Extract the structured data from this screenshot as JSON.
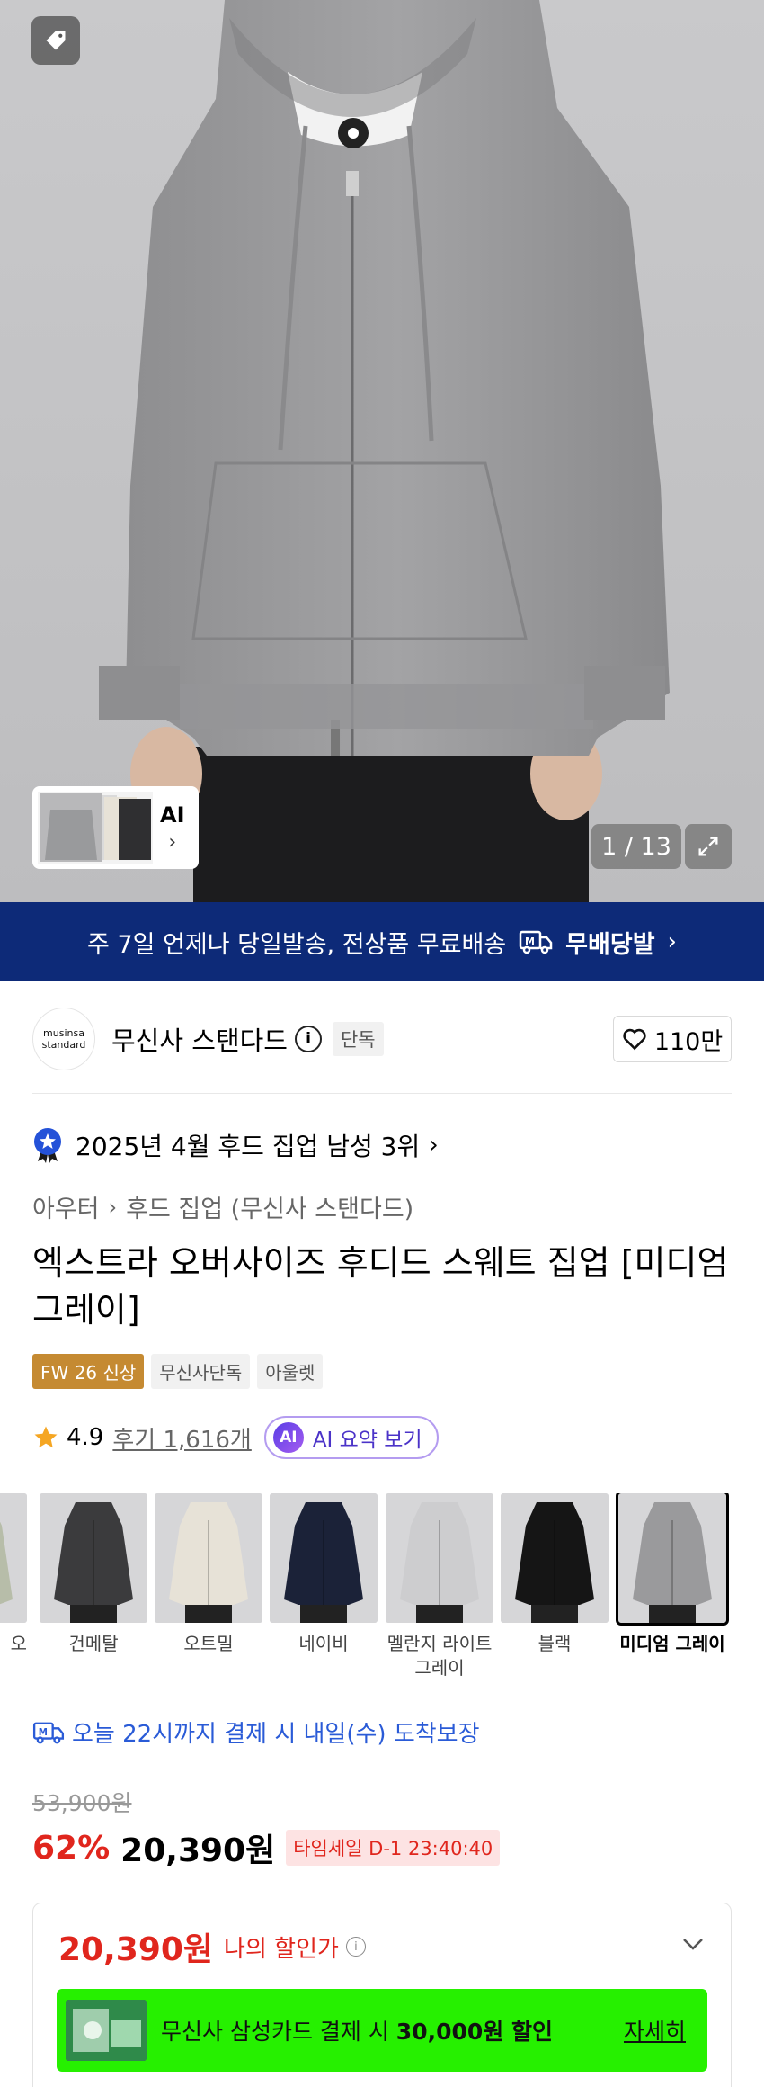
{
  "gallery": {
    "counter": "1 / 13",
    "ai_label": "AI",
    "ai_chevron": "›"
  },
  "banner": {
    "text": "주 7일 언제나 당일발송, 전상품 무료배송",
    "free_label": "무배당발",
    "chevron": "›",
    "background": "#0d2a78"
  },
  "brand": {
    "logo_line1": "musinsa",
    "logo_line2": "standard",
    "name": "무신사 스탠다드",
    "info": "i",
    "exclusive_badge": "단독",
    "likes": "110만"
  },
  "rank": {
    "text": "2025년 4월 후드 집업 남성 3위",
    "chevron": "›"
  },
  "breadcrumb": {
    "level1": "아우터",
    "sep": "›",
    "level2": "후드 집업 (무신사 스탠다드)"
  },
  "product": {
    "title": "엑스트라 오버사이즈 후디드 스웨트 집업 [미디엄 그레이]",
    "tags": [
      "FW 26 신상",
      "무신사단독",
      "아울렛"
    ]
  },
  "rating": {
    "score": "4.9",
    "reviews": "후기 1,616개",
    "ai_icon": "AI",
    "ai_summary": "AI 요약 보기"
  },
  "colors": [
    {
      "label": "오",
      "color": "#b7bda9"
    },
    {
      "label": "건메탈",
      "color": "#3b3b3d"
    },
    {
      "label": "오트밀",
      "color": "#e7e2d7"
    },
    {
      "label": "네이비",
      "color": "#1b2238"
    },
    {
      "label": "멜란지 라이트 그레이",
      "color": "#cdcdcf"
    },
    {
      "label": "블랙",
      "color": "#151515"
    },
    {
      "label": "미디엄 그레이",
      "color": "#9a9a9c"
    }
  ],
  "delivery": {
    "text": "오늘 22시까지 결제 시 내일(수) 도착보장",
    "color": "#2a5bd7"
  },
  "price": {
    "original": "53,900원",
    "discount": "62%",
    "sale": "20,390원",
    "timesale": "타임세일 D-1 23:40:40",
    "accent": "#e0261d"
  },
  "benefit": {
    "my_price": "20,390원",
    "my_label": "나의 할인가",
    "info": "i",
    "card_text_prefix": "무신사 삼성카드 결제 시 ",
    "card_text_bold": "30,000원 할인",
    "card_more": "자세히",
    "card_color": "#26f000"
  }
}
